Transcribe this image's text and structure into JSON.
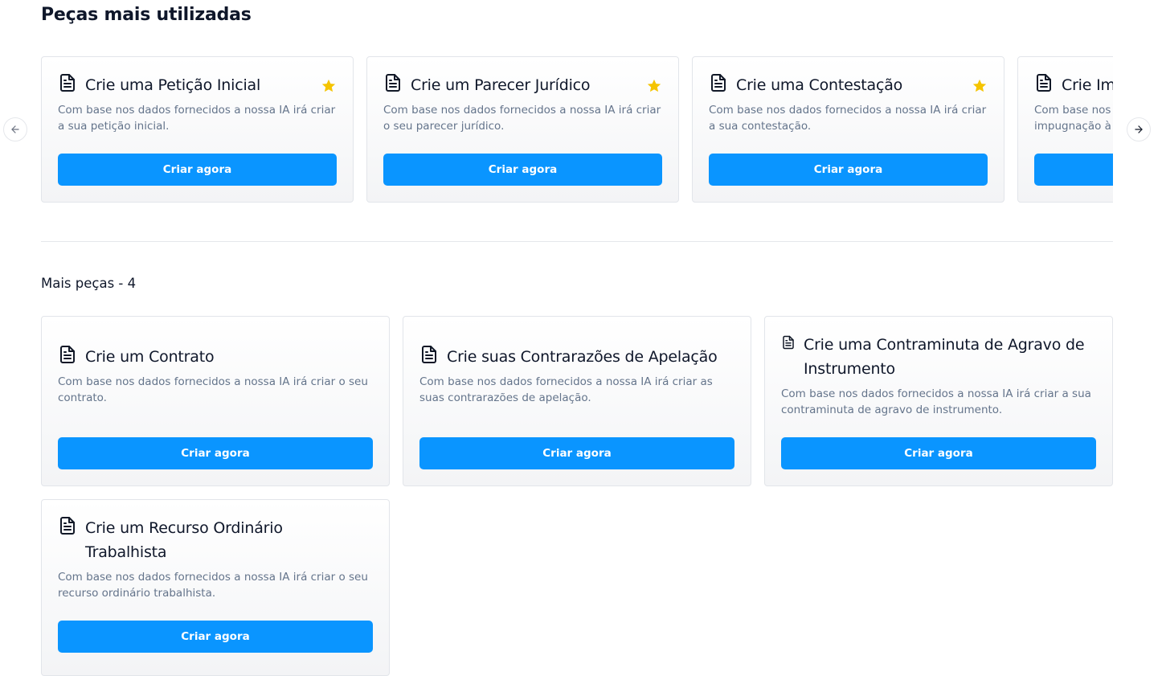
{
  "most_used": {
    "title": "Peças mais utilizadas",
    "button_label": "Criar agora",
    "prev_label": "Anterior",
    "next_label": "Próximo",
    "cards": [
      {
        "title": "Crie uma Petição Inicial",
        "desc_line1": "Com base nos dados fornecidos a nossa IA irá criar",
        "desc_line2": "a sua petição inicial.",
        "favorite": true
      },
      {
        "title": "Crie um Parecer Jurídico",
        "desc_line1": "Com base nos dados fornecidos a nossa IA irá criar",
        "desc_line2": "o seu parecer jurídico.",
        "favorite": true
      },
      {
        "title": "Crie uma Contestação",
        "desc_line1": "Com base nos dados fornecidos a nossa IA irá criar",
        "desc_line2": "a sua contestação.",
        "favorite": true
      },
      {
        "title": "Crie Im",
        "desc_line1": "Com base nos",
        "desc_line2": "impugnação à",
        "favorite": false
      }
    ]
  },
  "more": {
    "title": "Mais peças - 4",
    "button_label": "Criar agora",
    "cards": [
      {
        "title_line1": "Crie um Contrato",
        "title_line2": "",
        "desc_line1": "Com base nos dados fornecidos a nossa IA irá criar o seu",
        "desc_line2": "contrato."
      },
      {
        "title_line1": "Crie suas Contrarazões de Apelação",
        "title_line2": "",
        "desc_line1": "Com base nos dados fornecidos a nossa IA irá criar as",
        "desc_line2": "suas contrarazões de apelação."
      },
      {
        "title_line1": "Crie uma Contraminuta de Agravo de",
        "title_line2": "Instrumento",
        "desc_line1": "Com base nos dados fornecidos a nossa IA irá criar a sua",
        "desc_line2": "contraminuta de agravo de instrumento."
      },
      {
        "title_line1": "Crie um Recurso Ordinário",
        "title_line2": "Trabalhista",
        "desc_line1": "Com base nos dados fornecidos a nossa IA irá criar o seu",
        "desc_line2": "recurso ordinário trabalhista."
      }
    ]
  },
  "colors": {
    "accent": "#0a95ff",
    "star": "#f5c400",
    "muted_text": "#64748b"
  },
  "icons": {
    "card": "document-icon",
    "favorite": "star-icon",
    "prev": "arrow-left-icon",
    "next": "arrow-right-icon"
  }
}
